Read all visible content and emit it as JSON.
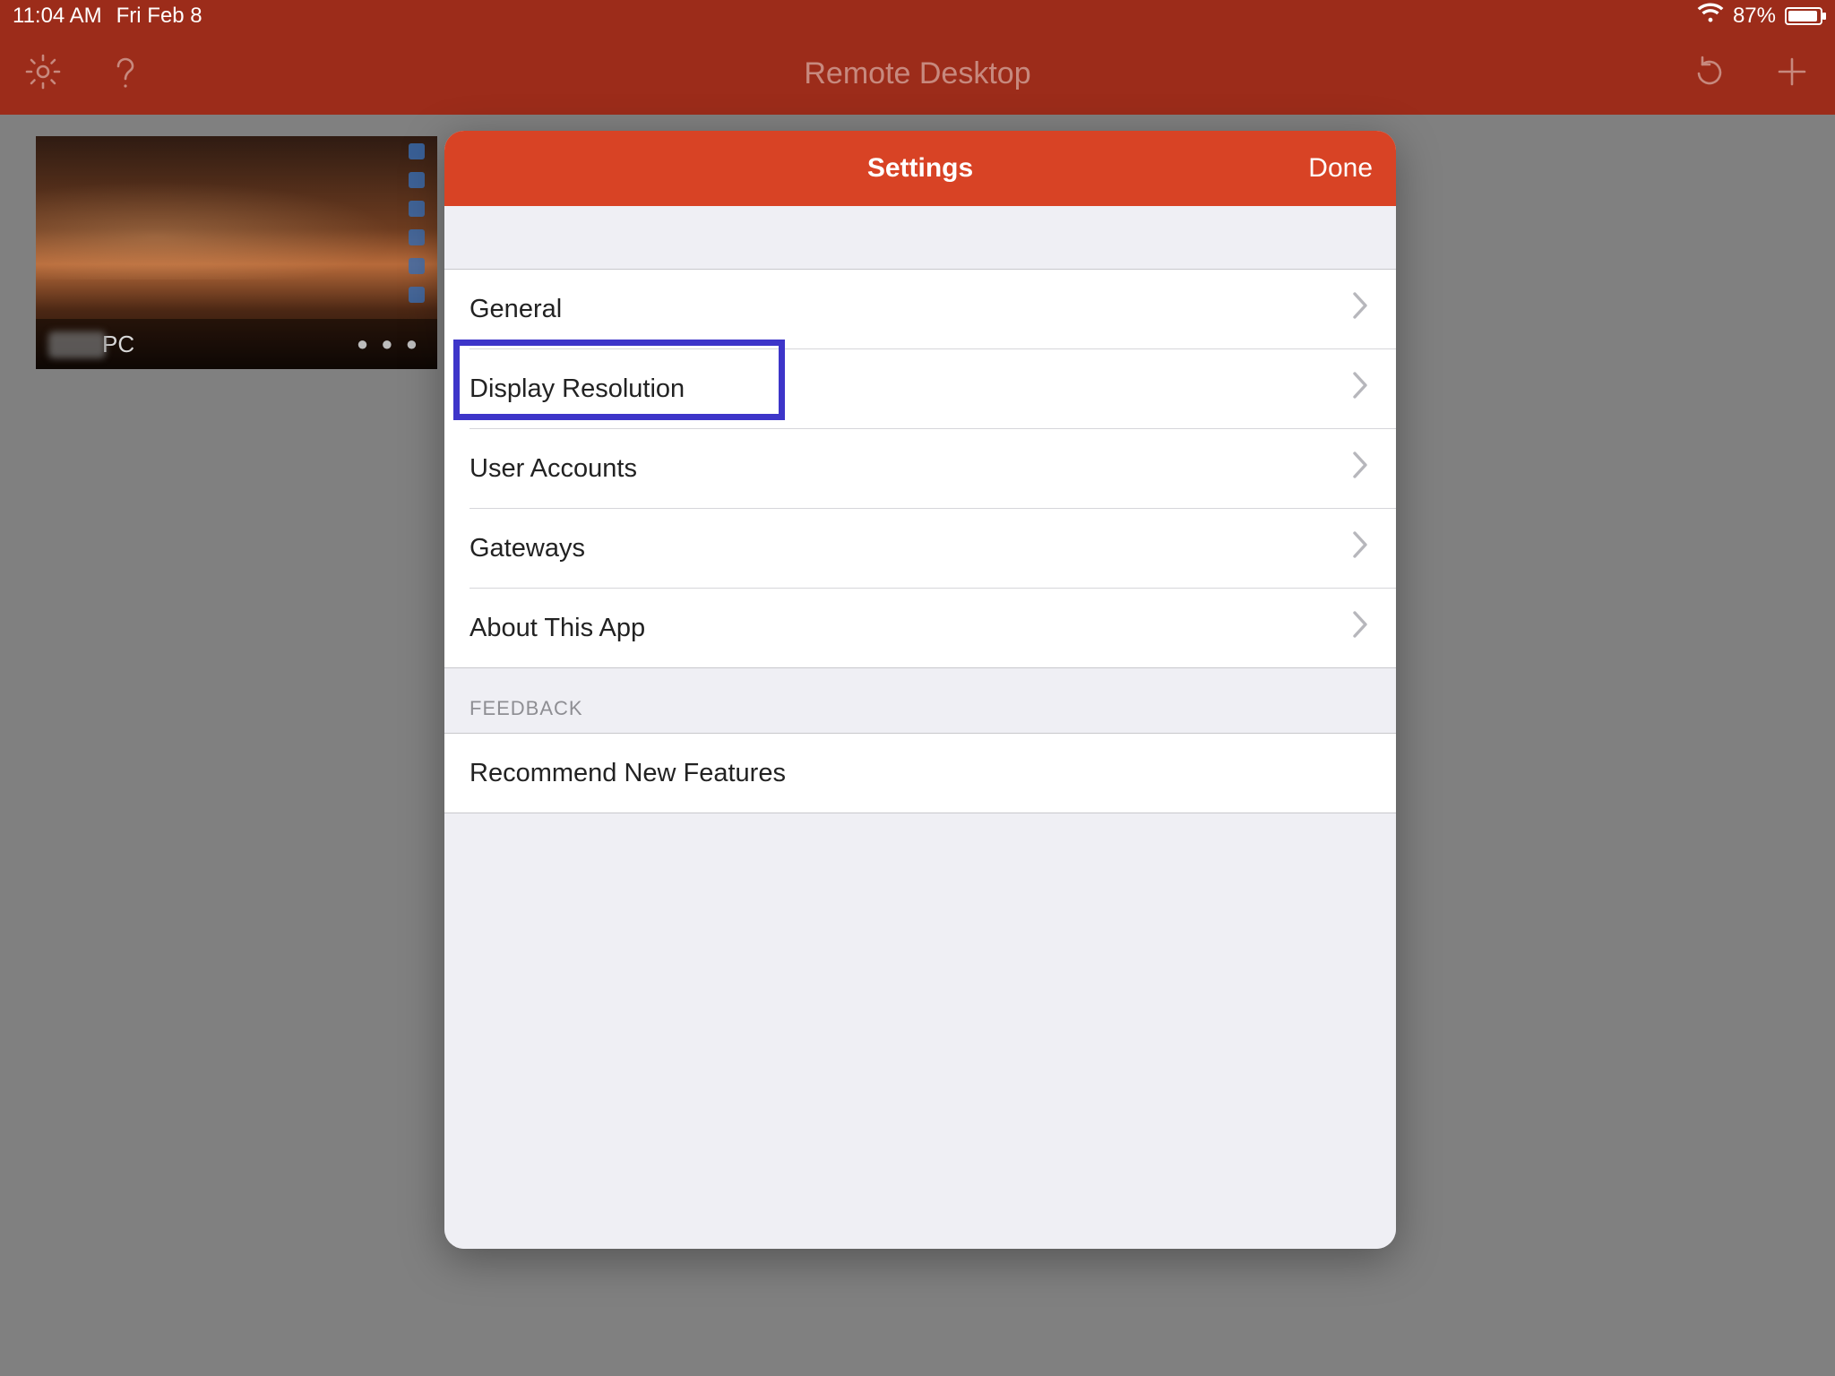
{
  "status": {
    "time": "11:04 AM",
    "date": "Fri Feb 8",
    "battery_pct": "87%"
  },
  "toolbar": {
    "title": "Remote Desktop"
  },
  "thumbnail": {
    "label": "PC",
    "dots": "● ● ●"
  },
  "modal": {
    "title": "Settings",
    "done_label": "Done",
    "section1_items": [
      {
        "label": "General"
      },
      {
        "label": "Display Resolution"
      },
      {
        "label": "User Accounts"
      },
      {
        "label": "Gateways"
      },
      {
        "label": "About This App"
      }
    ],
    "section2_header": "FEEDBACK",
    "section2_items": [
      {
        "label": "Recommend New Features"
      }
    ],
    "highlighted_item_index": 1
  },
  "colors": {
    "brand_red_dark": "#9c2c1a",
    "brand_red": "#d84325",
    "highlight": "#3d35c9",
    "grouped_bg": "#efeff4"
  }
}
